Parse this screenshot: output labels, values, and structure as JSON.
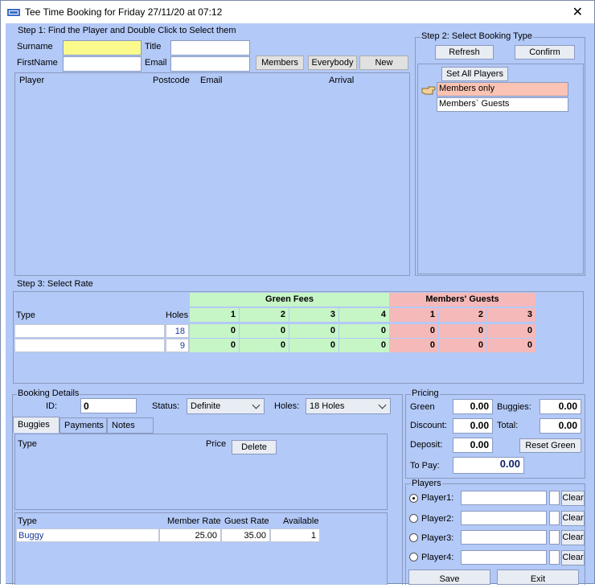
{
  "window": {
    "title": "Tee Time Booking for Friday 27/11/20 at 07:12"
  },
  "step1": {
    "legend": "Step 1: Find the Player and Double Click to Select them",
    "surname_label": "Surname",
    "title_label": "Title",
    "firstname_label": "FirstName",
    "email_label": "Email",
    "surname_value": "",
    "title_value": "",
    "firstname_value": "",
    "email_value": "",
    "members_btn": "Members",
    "everybody_btn": "Everybody",
    "new_btn": "New",
    "columns": [
      "Player",
      "Postcode",
      "Email",
      "Arrival"
    ]
  },
  "step2": {
    "legend": "Step 2: Select Booking Type",
    "refresh_btn": "Refresh",
    "confirm_btn": "Confirm",
    "set_all_btn": "Set All Players",
    "types": [
      "Members only",
      "Members` Guests"
    ],
    "selected_type": "Members only"
  },
  "step3": {
    "legend": "Step 3: Select Rate",
    "type_header": "Type",
    "holes_header": "Holes",
    "green_header": "Green Fees",
    "guest_header": "Members' Guests",
    "green_cols": [
      "1",
      "2",
      "3",
      "4"
    ],
    "guest_cols": [
      "1",
      "2",
      "3"
    ],
    "rows": [
      {
        "type": "",
        "holes": "18",
        "green": [
          "0",
          "0",
          "0",
          "0"
        ],
        "guest": [
          "0",
          "0",
          "0"
        ]
      },
      {
        "type": "",
        "holes": "9",
        "green": [
          "0",
          "0",
          "0",
          "0"
        ],
        "guest": [
          "0",
          "0",
          "0"
        ]
      }
    ]
  },
  "booking": {
    "legend": "Booking Details",
    "id_label": "ID:",
    "id_value": "0",
    "status_label": "Status:",
    "status_value": "Definite",
    "holes_label": "Holes:",
    "holes_value": "18 Holes",
    "tabs": [
      "Buggies",
      "Payments",
      "Notes"
    ],
    "active_tab": "Buggies",
    "upper_type_header": "Type",
    "upper_price_header": "Price",
    "delete_btn": "Delete",
    "lower_headers": {
      "type": "Type",
      "member_rate": "Member Rate",
      "guest_rate": "Guest Rate",
      "available": "Available"
    },
    "lower_rows": [
      {
        "type": "Buggy",
        "member_rate": "25.00",
        "guest_rate": "35.00",
        "available": "1"
      }
    ]
  },
  "pricing": {
    "legend": "Pricing",
    "green_label": "Green",
    "green_value": "0.00",
    "buggies_label": "Buggies:",
    "buggies_value": "0.00",
    "discount_label": "Discount:",
    "discount_value": "0.00",
    "total_label": "Total:",
    "total_value": "0.00",
    "deposit_label": "Deposit:",
    "deposit_value": "0.00",
    "reset_btn": "Reset Green",
    "topay_label": "To Pay:",
    "topay_value": "0.00"
  },
  "players": {
    "legend": "Players",
    "rows": [
      {
        "label": "Player1:",
        "value": "",
        "selected": true,
        "clear": "Clear"
      },
      {
        "label": "Player2:",
        "value": "",
        "selected": false,
        "clear": "Clear"
      },
      {
        "label": "Player3:",
        "value": "",
        "selected": false,
        "clear": "Clear"
      },
      {
        "label": "Player4:",
        "value": "",
        "selected": false,
        "clear": "Clear"
      }
    ],
    "save_btn": "Save",
    "exit_btn": "Exit"
  },
  "colors": {
    "window_bg": "#b3c9f7",
    "surname_highlight": "#fafa8c",
    "green_fee": "#c6f5c6",
    "guest_fee": "#f5b9b9",
    "selected_type": "#fbc3b3"
  }
}
